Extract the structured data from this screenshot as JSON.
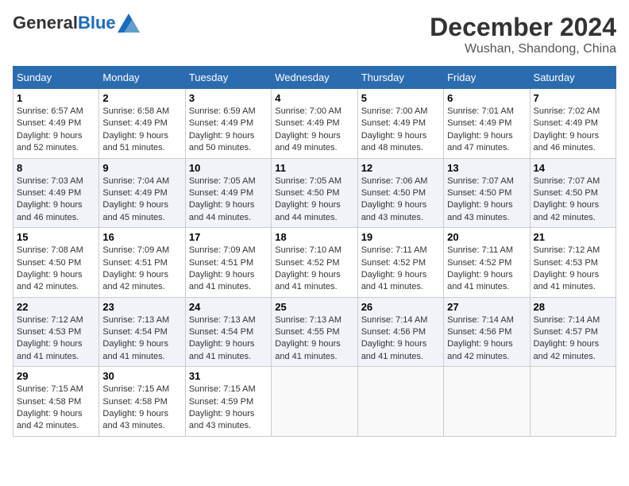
{
  "header": {
    "logo_general": "General",
    "logo_blue": "Blue",
    "month_year": "December 2024",
    "location": "Wushan, Shandong, China"
  },
  "weekdays": [
    "Sunday",
    "Monday",
    "Tuesday",
    "Wednesday",
    "Thursday",
    "Friday",
    "Saturday"
  ],
  "weeks": [
    [
      {
        "day": "1",
        "sunrise": "6:57 AM",
        "sunset": "4:49 PM",
        "daylight": "9 hours and 52 minutes."
      },
      {
        "day": "2",
        "sunrise": "6:58 AM",
        "sunset": "4:49 PM",
        "daylight": "9 hours and 51 minutes."
      },
      {
        "day": "3",
        "sunrise": "6:59 AM",
        "sunset": "4:49 PM",
        "daylight": "9 hours and 50 minutes."
      },
      {
        "day": "4",
        "sunrise": "7:00 AM",
        "sunset": "4:49 PM",
        "daylight": "9 hours and 49 minutes."
      },
      {
        "day": "5",
        "sunrise": "7:00 AM",
        "sunset": "4:49 PM",
        "daylight": "9 hours and 48 minutes."
      },
      {
        "day": "6",
        "sunrise": "7:01 AM",
        "sunset": "4:49 PM",
        "daylight": "9 hours and 47 minutes."
      },
      {
        "day": "7",
        "sunrise": "7:02 AM",
        "sunset": "4:49 PM",
        "daylight": "9 hours and 46 minutes."
      }
    ],
    [
      {
        "day": "8",
        "sunrise": "7:03 AM",
        "sunset": "4:49 PM",
        "daylight": "9 hours and 46 minutes."
      },
      {
        "day": "9",
        "sunrise": "7:04 AM",
        "sunset": "4:49 PM",
        "daylight": "9 hours and 45 minutes."
      },
      {
        "day": "10",
        "sunrise": "7:05 AM",
        "sunset": "4:49 PM",
        "daylight": "9 hours and 44 minutes."
      },
      {
        "day": "11",
        "sunrise": "7:05 AM",
        "sunset": "4:50 PM",
        "daylight": "9 hours and 44 minutes."
      },
      {
        "day": "12",
        "sunrise": "7:06 AM",
        "sunset": "4:50 PM",
        "daylight": "9 hours and 43 minutes."
      },
      {
        "day": "13",
        "sunrise": "7:07 AM",
        "sunset": "4:50 PM",
        "daylight": "9 hours and 43 minutes."
      },
      {
        "day": "14",
        "sunrise": "7:07 AM",
        "sunset": "4:50 PM",
        "daylight": "9 hours and 42 minutes."
      }
    ],
    [
      {
        "day": "15",
        "sunrise": "7:08 AM",
        "sunset": "4:50 PM",
        "daylight": "9 hours and 42 minutes."
      },
      {
        "day": "16",
        "sunrise": "7:09 AM",
        "sunset": "4:51 PM",
        "daylight": "9 hours and 42 minutes."
      },
      {
        "day": "17",
        "sunrise": "7:09 AM",
        "sunset": "4:51 PM",
        "daylight": "9 hours and 41 minutes."
      },
      {
        "day": "18",
        "sunrise": "7:10 AM",
        "sunset": "4:52 PM",
        "daylight": "9 hours and 41 minutes."
      },
      {
        "day": "19",
        "sunrise": "7:11 AM",
        "sunset": "4:52 PM",
        "daylight": "9 hours and 41 minutes."
      },
      {
        "day": "20",
        "sunrise": "7:11 AM",
        "sunset": "4:52 PM",
        "daylight": "9 hours and 41 minutes."
      },
      {
        "day": "21",
        "sunrise": "7:12 AM",
        "sunset": "4:53 PM",
        "daylight": "9 hours and 41 minutes."
      }
    ],
    [
      {
        "day": "22",
        "sunrise": "7:12 AM",
        "sunset": "4:53 PM",
        "daylight": "9 hours and 41 minutes."
      },
      {
        "day": "23",
        "sunrise": "7:13 AM",
        "sunset": "4:54 PM",
        "daylight": "9 hours and 41 minutes."
      },
      {
        "day": "24",
        "sunrise": "7:13 AM",
        "sunset": "4:54 PM",
        "daylight": "9 hours and 41 minutes."
      },
      {
        "day": "25",
        "sunrise": "7:13 AM",
        "sunset": "4:55 PM",
        "daylight": "9 hours and 41 minutes."
      },
      {
        "day": "26",
        "sunrise": "7:14 AM",
        "sunset": "4:56 PM",
        "daylight": "9 hours and 41 minutes."
      },
      {
        "day": "27",
        "sunrise": "7:14 AM",
        "sunset": "4:56 PM",
        "daylight": "9 hours and 42 minutes."
      },
      {
        "day": "28",
        "sunrise": "7:14 AM",
        "sunset": "4:57 PM",
        "daylight": "9 hours and 42 minutes."
      }
    ],
    [
      {
        "day": "29",
        "sunrise": "7:15 AM",
        "sunset": "4:58 PM",
        "daylight": "9 hours and 42 minutes."
      },
      {
        "day": "30",
        "sunrise": "7:15 AM",
        "sunset": "4:58 PM",
        "daylight": "9 hours and 43 minutes."
      },
      {
        "day": "31",
        "sunrise": "7:15 AM",
        "sunset": "4:59 PM",
        "daylight": "9 hours and 43 minutes."
      },
      null,
      null,
      null,
      null
    ]
  ],
  "labels": {
    "sunrise": "Sunrise:",
    "sunset": "Sunset:",
    "daylight": "Daylight:"
  }
}
